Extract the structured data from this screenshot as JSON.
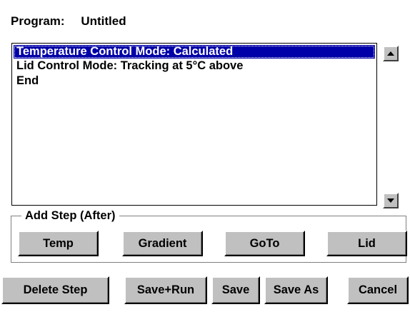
{
  "program": {
    "label": "Program:",
    "name": "Untitled"
  },
  "steps": [
    {
      "text": "Temperature Control Mode: Calculated",
      "selected": true
    },
    {
      "text": "Lid Control Mode: Tracking at  5°C above",
      "selected": false
    },
    {
      "text": "End",
      "selected": false
    }
  ],
  "add_step": {
    "legend": "Add Step (After)",
    "temp": "Temp",
    "gradient": "Gradient",
    "goto": "GoTo",
    "lid": "Lid"
  },
  "actions": {
    "delete_step": "Delete Step",
    "save_run": "Save+Run",
    "save": "Save",
    "save_as": "Save As",
    "cancel": "Cancel"
  },
  "icons": {
    "scroll_up": "up-arrow-icon",
    "scroll_down": "down-arrow-icon"
  },
  "colors": {
    "selection": "#0000a8",
    "button_face": "#c0c0c0"
  }
}
